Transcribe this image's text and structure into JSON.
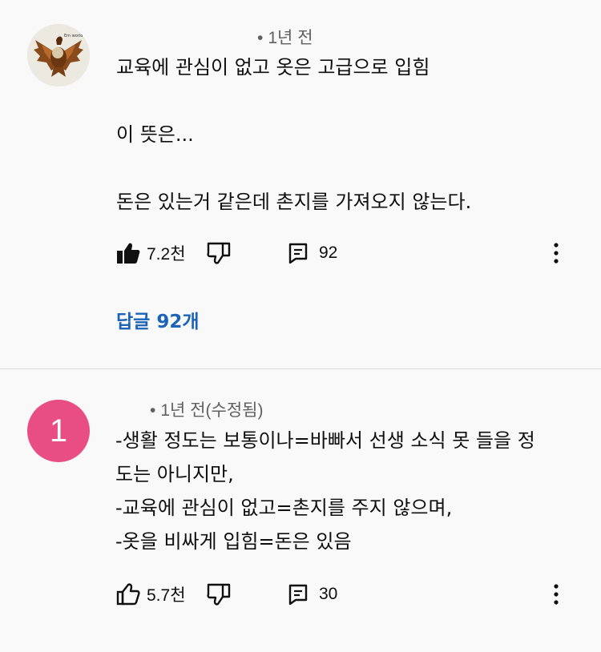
{
  "comments": [
    {
      "time": "1년 전",
      "body": "교육에 관심이 없고 옷은 고급으로 입힘\n\n이 뜻은...\n\n돈은 있는거 같은데 촌지를 가져오지 않는다.",
      "likes": "7.2천",
      "replies_count": "92",
      "replies_link": "답글 92개",
      "avatar_icon": "eagle-emblem-icon",
      "avatar_logo_text": "Em world co"
    },
    {
      "avatar_letter": "1",
      "avatar_color": "#e84d84",
      "time": "1년 전(수정됨)",
      "body": "-생활 정도는 보통이나=바빠서 선생 소식 못 들을 정\n도는 아니지만,\n-교육에 관심이 없고=촌지를 주지 않으며,\n-옷을 비싸게 입힘=돈은 있음",
      "likes": "5.7천",
      "replies_count": "30"
    }
  ],
  "colors": {
    "link": "#1c62b9",
    "meta": "#606060",
    "background": "#f9f9f9"
  }
}
